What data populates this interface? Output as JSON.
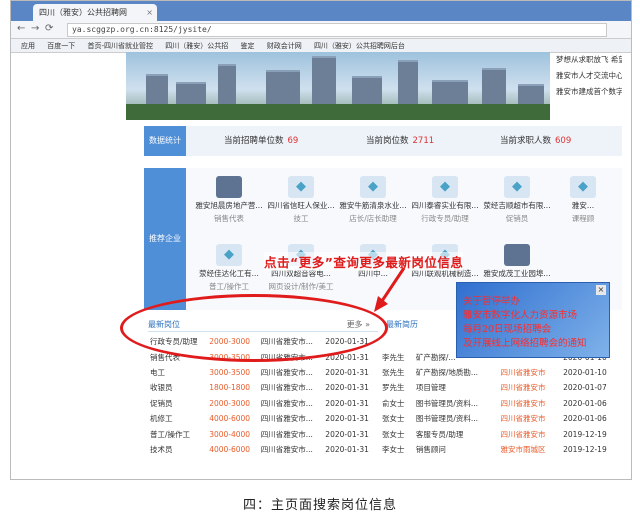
{
  "browser": {
    "tab_title": "四川（雅安）公共招聘网",
    "url": "ya.scggzp.org.cn:8125/jysite/",
    "bookmarks": [
      "应用",
      "百度一下",
      "首页-四川省就业管控",
      "四川（雅安）公共招",
      "鉴定",
      "财政会计网",
      "四川（雅安）公共招聘网后台"
    ]
  },
  "ticker": [
    "梦想从求职放飞 希望由",
    "雅安市人才交流中心主任",
    "雅安市建成首个数字化人"
  ],
  "stats": {
    "section_label": "数据统计",
    "items": [
      {
        "label": "当前招聘单位数",
        "value": "69"
      },
      {
        "label": "当前岗位数",
        "value": "2711"
      },
      {
        "label": "当前求职人数",
        "value": "609"
      }
    ]
  },
  "enterprises": {
    "section_label": "推荐企业",
    "row1": [
      {
        "name": "雅安旭晨房地产营...",
        "sub": "销售代表"
      },
      {
        "name": "四川省信旺人保业...",
        "sub": "技工"
      },
      {
        "name": "雅安牛筋清泉水业...",
        "sub": "店长/店长助理"
      },
      {
        "name": "四川泰睿实业有限...",
        "sub": "行政专员/助理"
      },
      {
        "name": "荥经吉顺超市有限...",
        "sub": "促销员"
      },
      {
        "name": "雅安...",
        "sub": "课程顾"
      }
    ],
    "row2": [
      {
        "name": "荥经佳达化工有...",
        "sub": "普工/操作工"
      },
      {
        "name": "四川双超音容电...",
        "sub": "网页设计/制作/美工"
      },
      {
        "name": "四川中...",
        "sub": ""
      },
      {
        "name": "四川联观机械制造...",
        "sub": ""
      },
      {
        "name": "雅安成茂工业园埠...",
        "sub": ""
      },
      {
        "name": "",
        "sub": ""
      }
    ]
  },
  "annotation": {
    "text": "点击“更多”查询更多最新岗位信息"
  },
  "jobs": {
    "title": "最新岗位",
    "more": "更多 »",
    "rows": [
      {
        "title": "行政专员/助理",
        "pay": "2000-3000",
        "place": "四川省雅安市...",
        "date": "2020-01-31"
      },
      {
        "title": "销售代表",
        "pay": "3000-3500",
        "place": "四川省雅安市...",
        "date": "2020-01-31"
      },
      {
        "title": "电工",
        "pay": "3000-3500",
        "place": "四川省雅安市...",
        "date": "2020-01-31"
      },
      {
        "title": "收银员",
        "pay": "1800-1800",
        "place": "四川省雅安市...",
        "date": "2020-01-31"
      },
      {
        "title": "促销员",
        "pay": "2000-3000",
        "place": "四川省雅安市...",
        "date": "2020-01-31"
      },
      {
        "title": "机修工",
        "pay": "4000-6000",
        "place": "四川省雅安市...",
        "date": "2020-01-31"
      },
      {
        "title": "普工/操作工",
        "pay": "3000-4000",
        "place": "四川省雅安市...",
        "date": "2020-01-31"
      },
      {
        "title": "技术员",
        "pay": "4000-6000",
        "place": "四川省雅安市...",
        "date": "2020-01-31"
      }
    ]
  },
  "resumes": {
    "title": "最新简历",
    "rows": [
      {
        "name": "",
        "job": "",
        "place": "",
        "date": ""
      },
      {
        "name": "李先生",
        "job": "矿产勘探/...",
        "place": "",
        "date": "2020-01-10"
      },
      {
        "name": "张先生",
        "job": "矿产勘探/地质勘...",
        "place": "四川省雅安市",
        "date": "2020-01-10"
      },
      {
        "name": "罗先生",
        "job": "项目管理",
        "place": "四川省雅安市",
        "date": "2020-01-07"
      },
      {
        "name": "俞女士",
        "job": "图书管理员/资料...",
        "place": "四川省雅安市",
        "date": "2020-01-06"
      },
      {
        "name": "张女士",
        "job": "图书管理员/资料...",
        "place": "四川省雅安市",
        "date": "2020-01-06"
      },
      {
        "name": "张女士",
        "job": "客服专员/助理",
        "place": "四川省雅安市",
        "date": "2019-12-19"
      },
      {
        "name": "李女士",
        "job": "销售顾问",
        "place": "雅安市雨城区",
        "date": "2019-12-19"
      }
    ]
  },
  "popup": {
    "close": "×",
    "lines": [
      "关于暂停举办",
      "雅安市数字化人力资源市场",
      "每月20日现场招聘会",
      "及开展线上网络招聘会的通知"
    ]
  },
  "caption": "四：主页面搜索岗位信息",
  "colors": {
    "accent": "#4f8fd8",
    "annotation": "#e01b1b",
    "salary": "#e85d2c"
  }
}
